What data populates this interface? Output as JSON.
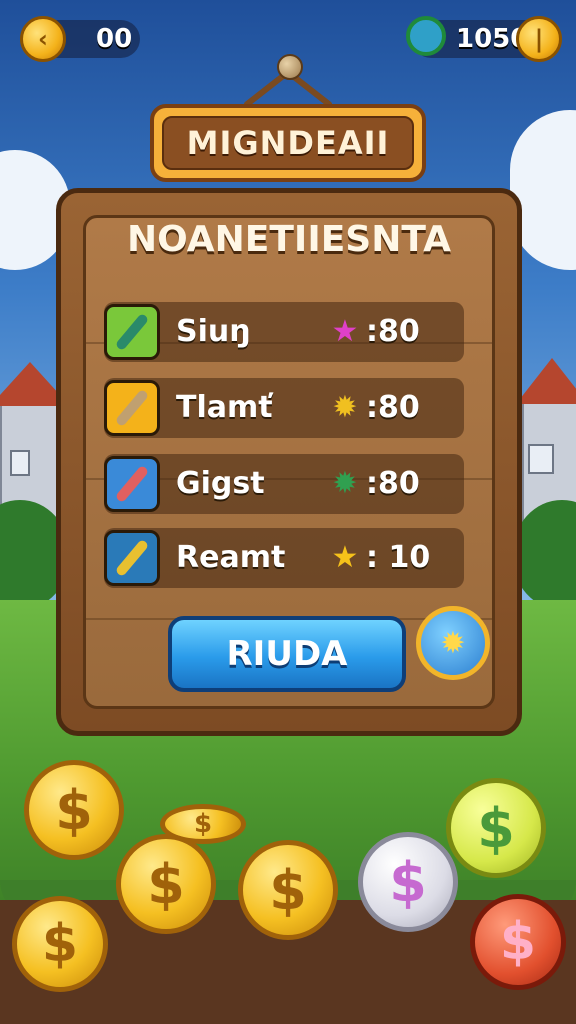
{
  "top_bar": {
    "left_value": "00",
    "right_value": "1050"
  },
  "sign": {
    "title": "MIGNDEAII",
    "board_title": "NOANETIIESNTA"
  },
  "rows": [
    {
      "label": "Siuŋ",
      "icon": "star-icon",
      "icon_glyph": "★",
      "icon_color": "#e040c8",
      "value": ":80",
      "tool_color": "#7ac83a",
      "handle_color": "#2a8a6a"
    },
    {
      "label": "Tlamť",
      "icon": "gear-icon",
      "icon_glyph": "✹",
      "icon_color": "#f0c020",
      "value": ":80",
      "tool_color": "#f4b21a",
      "handle_color": "#c0a070"
    },
    {
      "label": "Gigst",
      "icon": "gear-icon",
      "icon_glyph": "✹",
      "icon_color": "#30a050",
      "value": ":80",
      "tool_color": "#3a8ad8",
      "handle_color": "#e06060"
    },
    {
      "label": "Reamt",
      "icon": "star-icon",
      "icon_glyph": "★",
      "icon_color": "#f6c21a",
      "value": ": 10",
      "tool_color": "#2a7ab8",
      "handle_color": "#e8c030"
    }
  ],
  "play_button": {
    "label": "RIUDA"
  },
  "colors": {
    "accent_gold": "#f4b21a",
    "button_blue": "#2a9bea",
    "wood": "#9a6434"
  }
}
